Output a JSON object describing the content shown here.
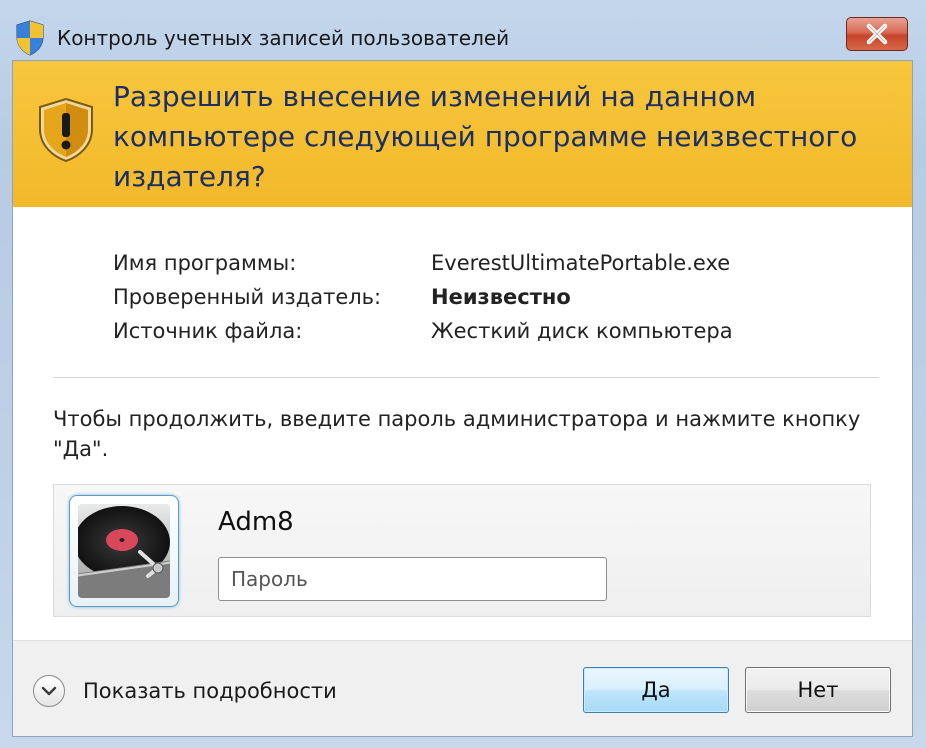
{
  "window": {
    "title": "Контроль учетных записей пользователей"
  },
  "banner": {
    "heading": "Разрешить внесение изменений на данном компьютере следующей программе неизвестного издателя?"
  },
  "details": [
    {
      "label": "Имя программы:",
      "value": "EverestUltimatePortable.exe",
      "emphasis": false
    },
    {
      "label": "Проверенный издатель:",
      "value": "Неизвестно",
      "emphasis": true
    },
    {
      "label": "Источник файла:",
      "value": "Жесткий диск компьютера",
      "emphasis": false
    }
  ],
  "instructions": "Чтобы продолжить, введите пароль администратора и нажмите кнопку \"Да\".",
  "credentials": {
    "username": "Adm8",
    "password_placeholder": "Пароль",
    "password_value": ""
  },
  "footer": {
    "show_details_label": "Показать подробности",
    "yes_label": "Да",
    "no_label": "Нет"
  },
  "icons": {
    "title_icon": "uac-shield-icon",
    "banner_icon": "warning-shield-icon",
    "close_icon": "close-icon",
    "details_icon": "chevron-down-icon"
  },
  "colors": {
    "banner_bg": "#f2b92a",
    "heading_text": "#1b2f64",
    "close_button": "#c6442a",
    "default_button_border": "#3c7fb1"
  }
}
